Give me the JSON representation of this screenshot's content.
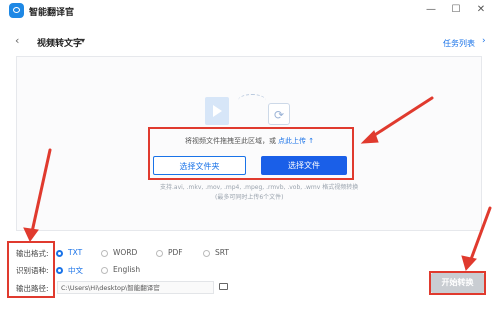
{
  "app": {
    "title": "智能翻译官",
    "logo_icon": "app-logo-icon"
  },
  "window_controls": {
    "minimize": "—",
    "maximize": "☐",
    "close": "✕"
  },
  "header": {
    "back": "‹",
    "title": "视频转文字",
    "dropdown": "▾",
    "task_list": "任务列表",
    "task_chevron": "›"
  },
  "dropzone": {
    "hint": "将视频文件拖拽至此区域，或",
    "upload_link": "点此上传 ↑",
    "select_folder": "选择文件夹",
    "select_file": "选择文件",
    "formats": "支持.avi, .mkv, .mov, .mp4, .mpeg, .rmvb, .vob, .wmv 格式视频转换",
    "limit": "(最多可同时上传6个文件)"
  },
  "options": {
    "output_format_label": "输出格式:",
    "formats": [
      "TXT",
      "WORD",
      "PDF",
      "SRT"
    ],
    "selected_format": "TXT",
    "language_label": "识别语种:",
    "languages": [
      "中文",
      "English"
    ],
    "selected_language": "中文",
    "path_label": "输出路径:",
    "path_value": "C:\\Users\\Hi\\desktop\\智能翻译官"
  },
  "start_button": "开始转换",
  "colors": {
    "accent": "#1a73e8",
    "annotation": "#e03a2e",
    "disabled": "#c9cdd2"
  }
}
